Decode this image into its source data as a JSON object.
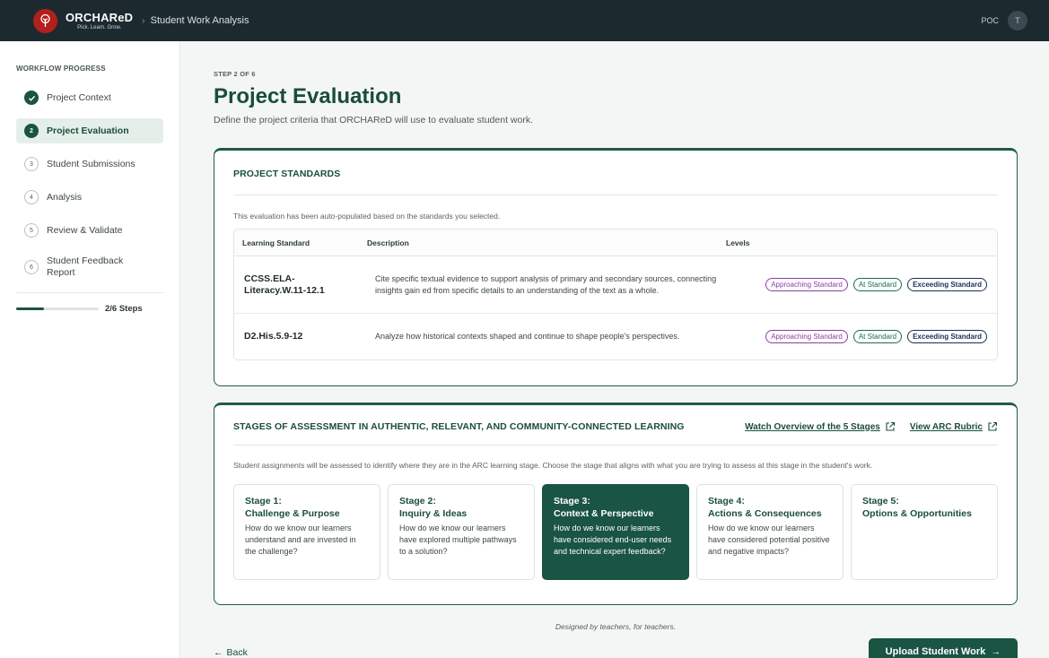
{
  "header": {
    "logo_name": "ORCHAReD",
    "logo_tagline": "Pick. Learn. Grow.",
    "breadcrumb": "Student Work Analysis",
    "user_role": "POC",
    "avatar_initial": "T"
  },
  "sidebar": {
    "heading": "WORKFLOW PROGRESS",
    "steps": [
      {
        "num": "1",
        "label": "Project Context",
        "state": "done"
      },
      {
        "num": "2",
        "label": "Project Evaluation",
        "state": "current"
      },
      {
        "num": "3",
        "label": "Student Submissions",
        "state": "todo"
      },
      {
        "num": "4",
        "label": "Analysis",
        "state": "todo"
      },
      {
        "num": "5",
        "label": "Review & Validate",
        "state": "todo"
      },
      {
        "num": "6",
        "label": "Student Feedback Report",
        "state": "todo"
      }
    ],
    "progress_fraction": 0.333,
    "progress_text": "2/6 Steps"
  },
  "main": {
    "step_label": "STEP 2 OF 6",
    "title": "Project Evaluation",
    "subtitle": "Define the project criteria that ORCHAReD will use to evaluate student work."
  },
  "standards": {
    "title": "PROJECT STANDARDS",
    "note": "This evaluation has been auto-populated based on the standards you selected.",
    "columns": [
      "Learning Standard",
      "Description",
      "Levels"
    ],
    "rows": [
      {
        "code": "CCSS.ELA-Literacy.W.11-12.1",
        "description": "Cite specific textual evidence to support analysis of primary and secondary sources, connecting insights gain ed from specific details to an understanding of the text as a whole.",
        "levels": [
          "Approaching Standard",
          "At Standard",
          "Exceeding Standard"
        ]
      },
      {
        "code": "D2.His.5.9-12",
        "description": "Analyze how historical contexts shaped and continue to shape people's perspectives.",
        "levels": [
          "Approaching Standard",
          "At Standard",
          "Exceeding Standard"
        ]
      }
    ]
  },
  "arc": {
    "title": "STAGES OF ASSESSMENT IN AUTHENTIC, RELEVANT, AND COMMUNITY-CONNECTED LEARNING",
    "link_overview": "Watch Overview of the 5 Stages",
    "link_rubric": "View ARC Rubric",
    "note": "Student assignments will be assessed to identify where they are in the ARC learning stage. Choose the stage that aligns with what you are trying to assess at this stage in the student's work.",
    "stages": [
      {
        "name_line1": "Stage 1:",
        "name_line2": "Challenge & Purpose",
        "question": "How do we know our learners understand and are invested in the challenge?"
      },
      {
        "name_line1": "Stage 2:",
        "name_line2": "Inquiry & Ideas",
        "question": "How do we know our learners have explored multiple pathways to a solution?"
      },
      {
        "name_line1": "Stage 3:",
        "name_line2": "Context & Perspective",
        "question": "How do we know our learners have considered end-user needs and technical expert feedback?"
      },
      {
        "name_line1": "Stage 4:",
        "name_line2": "Actions & Consequences",
        "question": "How do we know our learners have considered potential positive and negative impacts?"
      },
      {
        "name_line1": "Stage 5:",
        "name_line2": "Options & Opportunities",
        "question": ""
      }
    ],
    "selected_stage": "Stage 3:"
  },
  "footer": {
    "tagline": "Designed by teachers, for teachers.",
    "back_label": "Back",
    "upload_label": "Upload Student Work"
  },
  "colors": {
    "brand_green": "#1a5443",
    "topbar": "#1c2a30",
    "logo_red": "#b3201c"
  }
}
